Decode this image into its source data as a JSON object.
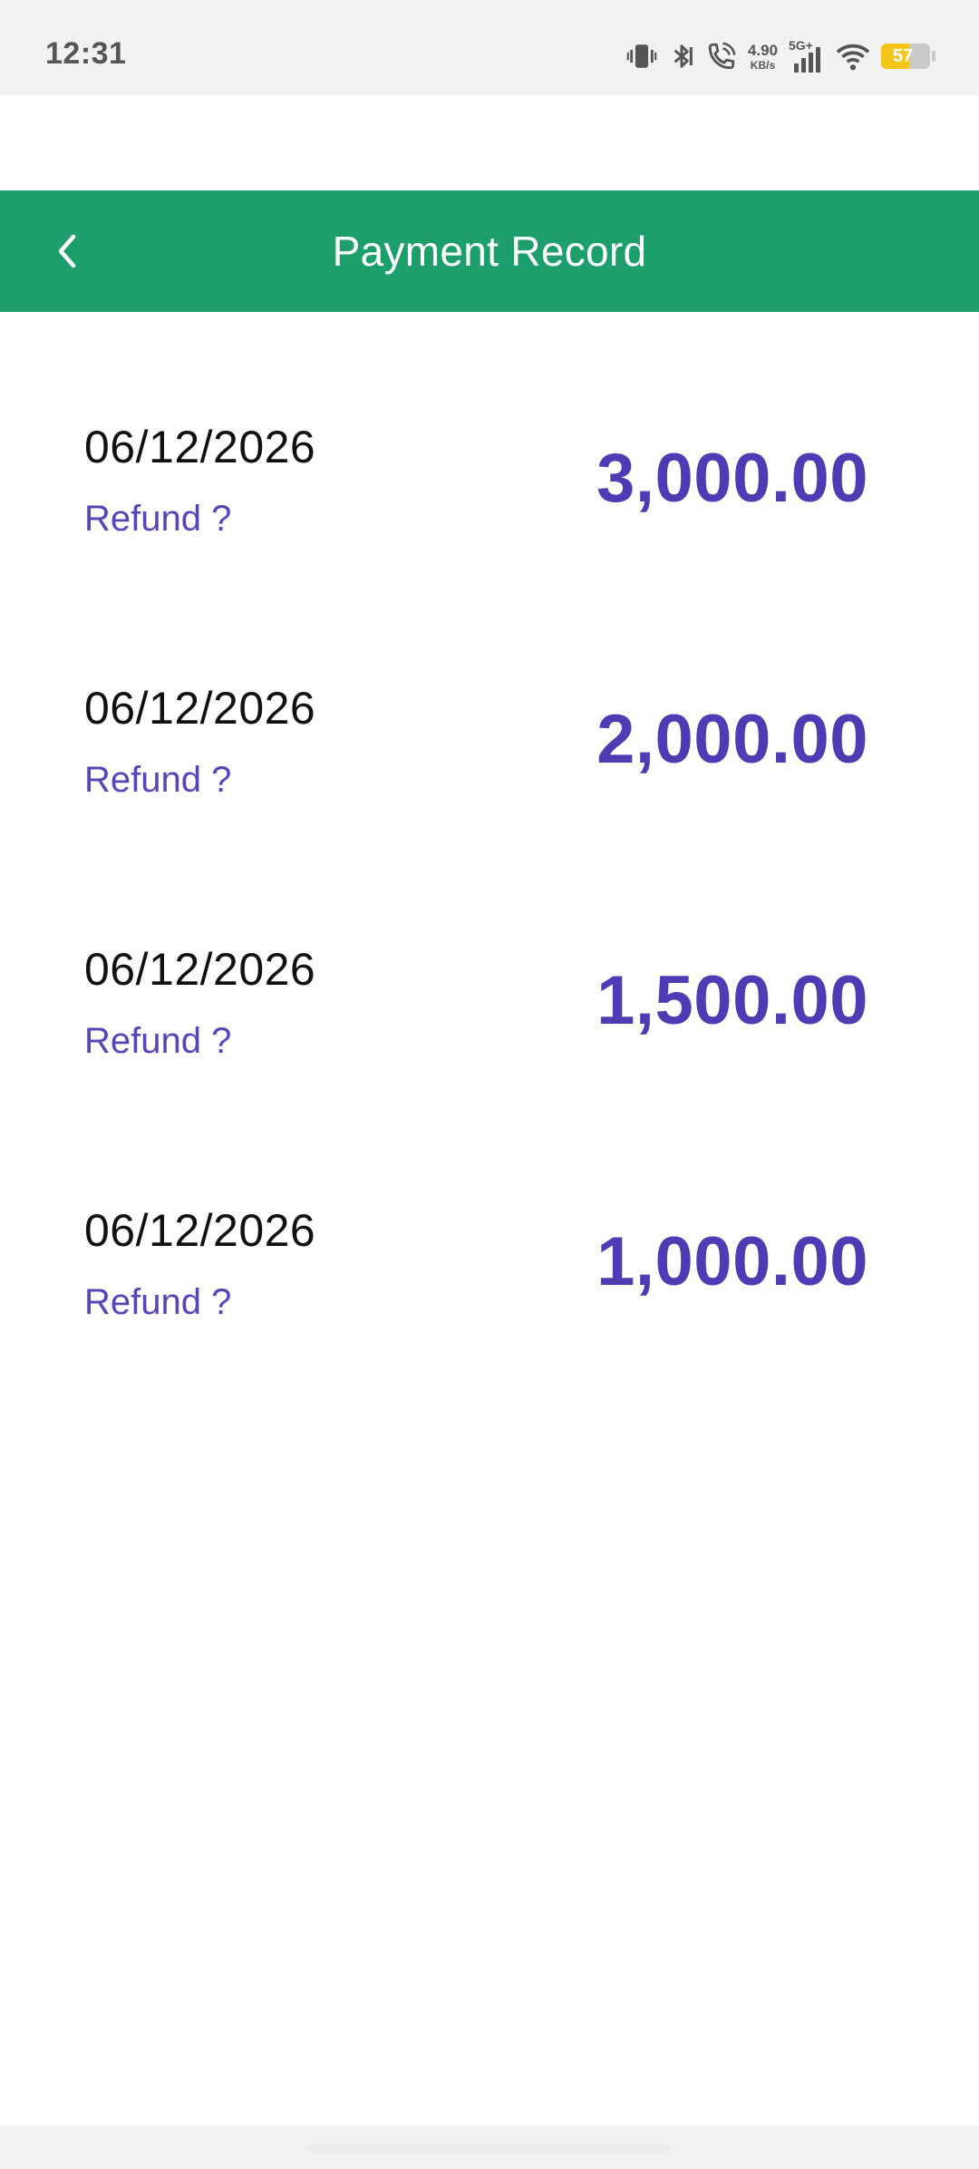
{
  "status_bar": {
    "time": "12:31",
    "net_speed_value": "4.90",
    "net_speed_unit": "KB/s",
    "network_type": "5G+",
    "battery_level": "57",
    "battery_fraction": 0.57,
    "icons": [
      "vibrate-icon",
      "bluetooth-icon",
      "wifi-call-icon",
      "cellular-signal-icon",
      "wifi-icon",
      "battery-icon"
    ]
  },
  "header": {
    "title": "Payment Record",
    "background_color": "#1c9f6a",
    "back_icon": "chevron-left-icon"
  },
  "records": [
    {
      "date": "06/12/2026",
      "refund_label": "Refund ?",
      "amount": "3,000.00"
    },
    {
      "date": "06/12/2026",
      "refund_label": "Refund ?",
      "amount": "2,000.00"
    },
    {
      "date": "06/12/2026",
      "refund_label": "Refund ?",
      "amount": "1,500.00"
    },
    {
      "date": "06/12/2026",
      "refund_label": "Refund ?",
      "amount": "1,000.00"
    }
  ],
  "colors": {
    "amount": "#4e3cb4",
    "refund_link": "#5a44b8",
    "date": "#111111"
  }
}
